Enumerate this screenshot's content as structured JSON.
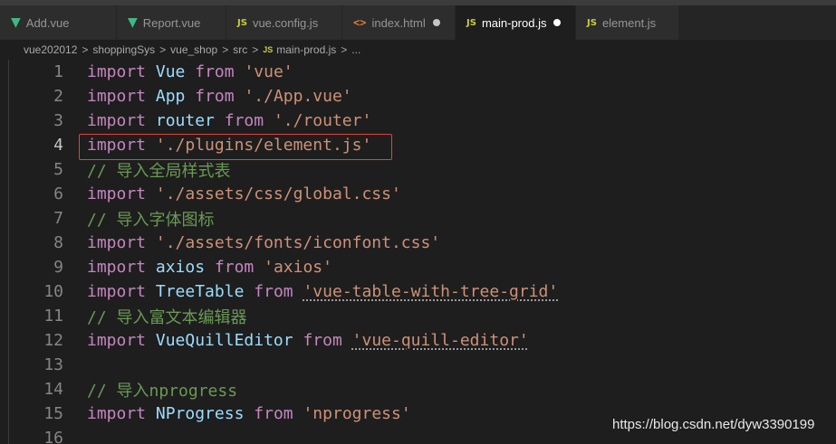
{
  "tabs": [
    {
      "label": "Add.vue",
      "icon": "vue-icon",
      "active": false,
      "modified": false
    },
    {
      "label": "Report.vue",
      "icon": "vue-icon",
      "active": false,
      "modified": false
    },
    {
      "label": "vue.config.js",
      "icon": "js-icon",
      "active": false,
      "modified": false
    },
    {
      "label": "index.html",
      "icon": "html-icon",
      "active": false,
      "modified": true
    },
    {
      "label": "main-prod.js",
      "icon": "js-icon",
      "active": true,
      "modified": true
    },
    {
      "label": "element.js",
      "icon": "js-icon",
      "active": false,
      "modified": false
    }
  ],
  "icons": {
    "vue": "▼",
    "js": "JS",
    "html": "<>"
  },
  "breadcrumb": [
    "vue202012",
    "shoppingSys",
    "vue_shop",
    "src",
    "main-prod.js",
    "..."
  ],
  "breadcrumb_sep": ">",
  "code_lines": [
    {
      "n": "1",
      "tokens": [
        [
          "kw",
          "import"
        ],
        [
          "pl",
          " "
        ],
        [
          "var",
          "Vue"
        ],
        [
          "pl",
          " "
        ],
        [
          "kw",
          "from"
        ],
        [
          "pl",
          " "
        ],
        [
          "str",
          "'vue'"
        ]
      ]
    },
    {
      "n": "2",
      "tokens": [
        [
          "kw",
          "import"
        ],
        [
          "pl",
          " "
        ],
        [
          "var",
          "App"
        ],
        [
          "pl",
          " "
        ],
        [
          "kw",
          "from"
        ],
        [
          "pl",
          " "
        ],
        [
          "str",
          "'./App.vue'"
        ]
      ]
    },
    {
      "n": "3",
      "tokens": [
        [
          "kw",
          "import"
        ],
        [
          "pl",
          " "
        ],
        [
          "var",
          "router"
        ],
        [
          "pl",
          " "
        ],
        [
          "kw",
          "from"
        ],
        [
          "pl",
          " "
        ],
        [
          "str",
          "'./router'"
        ]
      ]
    },
    {
      "n": "4",
      "tokens": [
        [
          "kw",
          "import"
        ],
        [
          "pl",
          " "
        ],
        [
          "str",
          "'./plugins/element.js'"
        ]
      ],
      "current": true
    },
    {
      "n": "5",
      "tokens": [
        [
          "com",
          "// 导入全局样式表"
        ]
      ]
    },
    {
      "n": "6",
      "tokens": [
        [
          "kw",
          "import"
        ],
        [
          "pl",
          " "
        ],
        [
          "str",
          "'./assets/css/global.css'"
        ]
      ]
    },
    {
      "n": "7",
      "tokens": [
        [
          "com",
          "// 导入字体图标"
        ]
      ]
    },
    {
      "n": "8",
      "tokens": [
        [
          "kw",
          "import"
        ],
        [
          "pl",
          " "
        ],
        [
          "str",
          "'./assets/fonts/iconfont.css'"
        ]
      ]
    },
    {
      "n": "9",
      "tokens": [
        [
          "kw",
          "import"
        ],
        [
          "pl",
          " "
        ],
        [
          "var",
          "axios"
        ],
        [
          "pl",
          " "
        ],
        [
          "kw",
          "from"
        ],
        [
          "pl",
          " "
        ],
        [
          "str",
          "'axios'"
        ]
      ]
    },
    {
      "n": "10",
      "tokens": [
        [
          "kw",
          "import"
        ],
        [
          "pl",
          " "
        ],
        [
          "var",
          "TreeTable"
        ],
        [
          "pl",
          " "
        ],
        [
          "kw",
          "from"
        ],
        [
          "pl",
          " "
        ],
        [
          "str",
          "'vue-table-with-tree-grid'",
          "squig"
        ]
      ]
    },
    {
      "n": "11",
      "tokens": [
        [
          "com",
          "// 导入富文本编辑器"
        ]
      ]
    },
    {
      "n": "12",
      "tokens": [
        [
          "kw",
          "import"
        ],
        [
          "pl",
          " "
        ],
        [
          "var",
          "VueQuillEditor"
        ],
        [
          "pl",
          " "
        ],
        [
          "kw",
          "from"
        ],
        [
          "pl",
          " "
        ],
        [
          "str",
          "'vue-quill-editor'",
          "squig"
        ]
      ]
    },
    {
      "n": "13",
      "tokens": []
    },
    {
      "n": "14",
      "tokens": [
        [
          "com",
          "// 导入nprogress"
        ]
      ]
    },
    {
      "n": "15",
      "tokens": [
        [
          "kw",
          "import"
        ],
        [
          "pl",
          " "
        ],
        [
          "var",
          "NProgress"
        ],
        [
          "pl",
          " "
        ],
        [
          "kw",
          "from"
        ],
        [
          "pl",
          " "
        ],
        [
          "str",
          "'nprogress'"
        ]
      ]
    },
    {
      "n": "16",
      "tokens": []
    }
  ],
  "watermark": "https://blog.csdn.net/dyw3390199",
  "colors": {
    "keyword": "#c586c0",
    "variable": "#9cdcfe",
    "string": "#ce9178",
    "comment": "#6a9955",
    "highlight_box": "#e0443e",
    "modified_dot_active": "#ffffff",
    "modified_dot_inactive": "#c5c5c5"
  }
}
